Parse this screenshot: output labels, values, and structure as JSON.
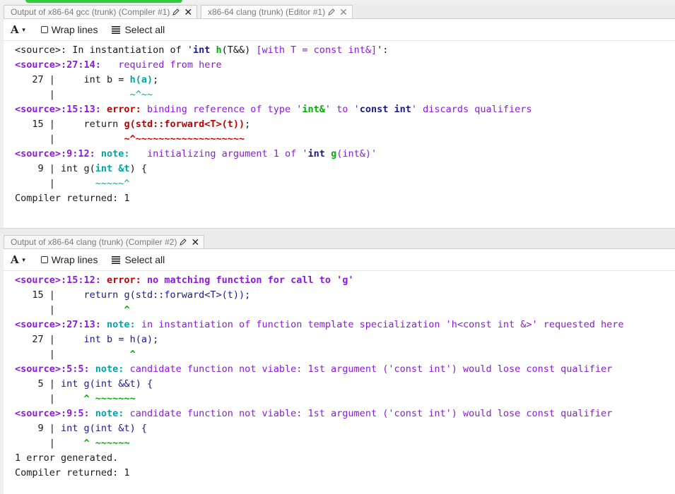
{
  "pane1": {
    "tabs": [
      {
        "label": "Output of x86-64 gcc (trunk) (Compiler #1)"
      },
      {
        "label": "x86-64 clang (trunk) (Editor #1)"
      }
    ],
    "toolbar": {
      "font_label": "A",
      "wrap_label": "Wrap lines",
      "select_label": "Select all"
    },
    "lines": {
      "l1": [
        "<source>: In instantiation of '",
        "int ",
        "h",
        "(T&&) ",
        "[with T = const int&]",
        "':"
      ],
      "l2": [
        "<source>:27:14:",
        "   required from here"
      ],
      "l3": [
        "   27 |     int b = ",
        "h(a)",
        ";"
      ],
      "l4": [
        "      |             ",
        "~^~~"
      ],
      "l5": [
        "<source>:15:13: ",
        "error: ",
        "binding reference of type '",
        "int&",
        "' to '",
        "const int",
        "' discards qualifiers"
      ],
      "l6": [
        "   15 |     return ",
        "g(std::forward<T>(t))",
        ";"
      ],
      "l7": [
        "      |            ",
        "~^~~~~~~~~~~~~~~~~~~~"
      ],
      "l8": [
        "<source>:9:12: ",
        "note: ",
        "  initializing argument 1 of '",
        "int ",
        "g",
        "(int&)'"
      ],
      "l9": [
        "    9 | int g(",
        "int &t",
        ") {"
      ],
      "l10": [
        "      |       ",
        "~~~~~^"
      ],
      "l11": "Compiler returned: 1"
    }
  },
  "pane2": {
    "tabs": [
      {
        "label": "Output of x86-64 clang (trunk) (Compiler #2)"
      }
    ],
    "toolbar": {
      "font_label": "A",
      "wrap_label": "Wrap lines",
      "select_label": "Select all"
    },
    "lines": {
      "l1": [
        "<source>:15:12: ",
        "error: ",
        "no matching function for call to 'g'"
      ],
      "l2": [
        "   15 |     ",
        "return g(std::forward<T>(t));"
      ],
      "l3": [
        "      |            ",
        "^"
      ],
      "l4": [
        "<source>:27:13: ",
        "note: ",
        "in instantiation of function template specialization 'h<const int &>' requested here"
      ],
      "l5": [
        "   27 |     ",
        "int b = h(a);"
      ],
      "l6": [
        "      |             ",
        "^"
      ],
      "l7": [
        "<source>:5:5: ",
        "note: ",
        "candidate function not viable: 1st argument ('const int') would lose const qualifier"
      ],
      "l8": [
        "    5 | ",
        "int g(int &&t) {"
      ],
      "l9": [
        "      |     ",
        "^ ~~~~~~~"
      ],
      "l10": [
        "<source>:9:5: ",
        "note: ",
        "candidate function not viable: 1st argument ('const int') would lose const qualifier"
      ],
      "l11": [
        "    9 | ",
        "int g(int &t) {"
      ],
      "l12": [
        "      |     ",
        "^ ~~~~~~"
      ],
      "l13": "1 error generated.",
      "l14": "Compiler returned: 1"
    }
  },
  "colors": {
    "purple": "#8c1adb",
    "error": "#c00000",
    "note": "#00a6a6",
    "green": "#00b000",
    "navy": "#1a1a8c"
  }
}
